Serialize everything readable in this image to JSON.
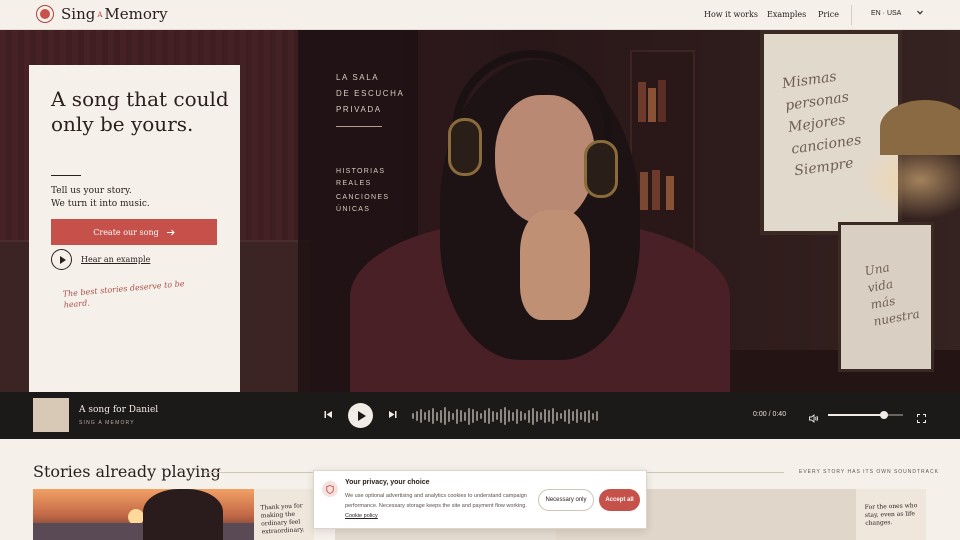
{
  "brand": {
    "name_part1": "Sing",
    "name_a": "A",
    "name_part2": "Memory"
  },
  "nav": {
    "how": "How it works",
    "examples": "Examples",
    "price": "Price",
    "lang": "EN · USA"
  },
  "hero": {
    "title": "A song that could only be yours.",
    "subtitle_line1": "Tell us your story.",
    "subtitle_line2": "We turn it into music.",
    "cta": "Create our song",
    "hear": "Hear an example",
    "tagline": "The best stories deserve to be heard.",
    "side_title_1": "LA SALA",
    "side_title_2": "DE ESCUCHA",
    "side_title_3": "PRIVADA",
    "side_a1": "HISTORIAS",
    "side_a2": "REALES",
    "side_b1": "CANCIONES",
    "side_b2": "ÚNICAS",
    "frame_lines": [
      "Mismas",
      "personas",
      "Mejores",
      "canciones",
      "Siempre"
    ],
    "frame2_lines": [
      "Una",
      "vida",
      "más",
      "nuestra"
    ]
  },
  "player": {
    "title": "A song for Daniel",
    "artist": "SING A MEMORY",
    "time_current": "0:00",
    "time_total": "0:40",
    "progress": 0,
    "volume": 0.75
  },
  "stories": {
    "title": "Stories already playing",
    "note": "EVERY STORY HAS ITS OWN SOUNDTRACK",
    "card1_note": "Thank you for making the ordinary feel extraordinary.",
    "card2_note": "For the ones who stay, even as life changes."
  },
  "cookie": {
    "title": "Your privacy, your choice",
    "body": "We use optional advertising and analytics cookies to understand campaign performance. Necessary storage keeps the site and payment flow working.",
    "link": "Cookie policy",
    "necessary": "Necessary only",
    "accept": "Accept all"
  },
  "colors": {
    "accent": "#c6504a",
    "background": "#f5f0ea",
    "player": "#1c1919"
  }
}
